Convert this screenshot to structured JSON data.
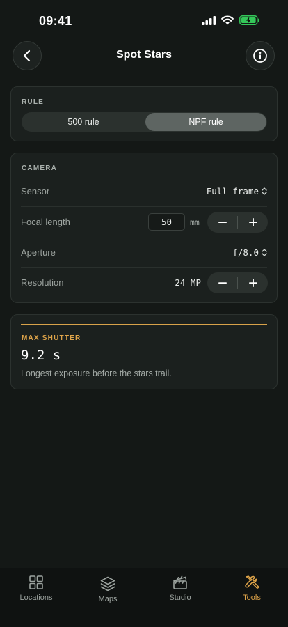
{
  "status": {
    "time": "09:41"
  },
  "header": {
    "title": "Spot Stars"
  },
  "rule": {
    "label": "RULE",
    "options": [
      "500 rule",
      "NPF rule"
    ],
    "selected": "NPF rule"
  },
  "camera": {
    "label": "CAMERA",
    "sensor": {
      "label": "Sensor",
      "value": "Full frame"
    },
    "focal_length": {
      "label": "Focal length",
      "value": "50",
      "unit": "mm"
    },
    "aperture": {
      "label": "Aperture",
      "value": "f/8.0"
    },
    "resolution": {
      "label": "Resolution",
      "value": "24 MP"
    }
  },
  "result": {
    "label": "MAX SHUTTER",
    "value": "9.2 s",
    "description": "Longest exposure before the stars trail."
  },
  "tabs": [
    {
      "label": "Locations",
      "icon": "grid-icon"
    },
    {
      "label": "Maps",
      "icon": "layers-icon"
    },
    {
      "label": "Studio",
      "icon": "clapperboard-icon"
    },
    {
      "label": "Tools",
      "icon": "tools-icon",
      "active": true
    }
  ],
  "colors": {
    "accent": "#e0a54a",
    "background": "#141816",
    "card": "#1b201e",
    "battery": "#34c759"
  }
}
